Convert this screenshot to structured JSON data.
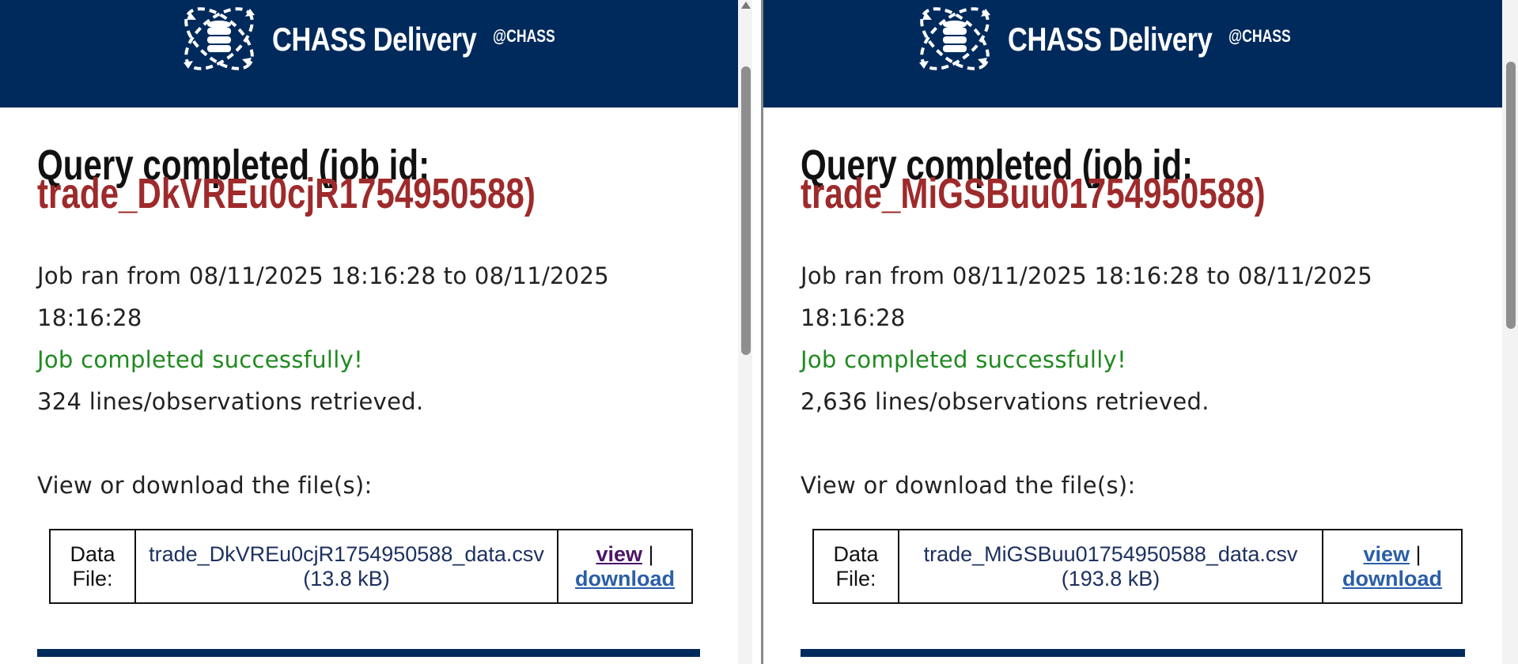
{
  "colors": {
    "header_bg": "#002a5c",
    "job_id_red": "#9e2a2b",
    "success_green": "#1f8a1f",
    "visited_link": "#4b1569",
    "link_blue": "#2a5ea8"
  },
  "icons": {
    "logo": "database-globe-icon"
  },
  "left": {
    "header": {
      "brand": "CHASS Delivery",
      "tag": "@CHASS"
    },
    "title": {
      "line1": "Query completed (job id:",
      "line2": "trade_DkVREu0cjR1754950588)"
    },
    "ran_line1": "Job ran from 08/11/2025 18:16:28 to 08/11/2025",
    "ran_line2": "18:16:28",
    "status": "Job completed successfully!",
    "count": "324 lines/observations retrieved.",
    "view_heading": "View or download the file(s):",
    "table": {
      "label_line1": "Data",
      "label_line2": "File:",
      "filename": "trade_DkVREu0cjR1754950588_data.csv",
      "size": "(13.8 kB)",
      "view": "view",
      "separator": "|",
      "download": "download"
    }
  },
  "right": {
    "header": {
      "brand": "CHASS Delivery",
      "tag": "@CHASS"
    },
    "title": {
      "line1": "Query completed (job id:",
      "line2": "trade_MiGSBuu01754950588)"
    },
    "ran_line1": "Job ran from 08/11/2025 18:16:28 to 08/11/2025",
    "ran_line2": "18:16:28",
    "status": "Job completed successfully!",
    "count": "2,636 lines/observations retrieved.",
    "view_heading": "View or download the file(s):",
    "table": {
      "label_line1": "Data",
      "label_line2": "File:",
      "filename": "trade_MiGSBuu01754950588_data.csv",
      "size": "(193.8 kB)",
      "view": "view",
      "separator": "|",
      "download": "download"
    }
  }
}
